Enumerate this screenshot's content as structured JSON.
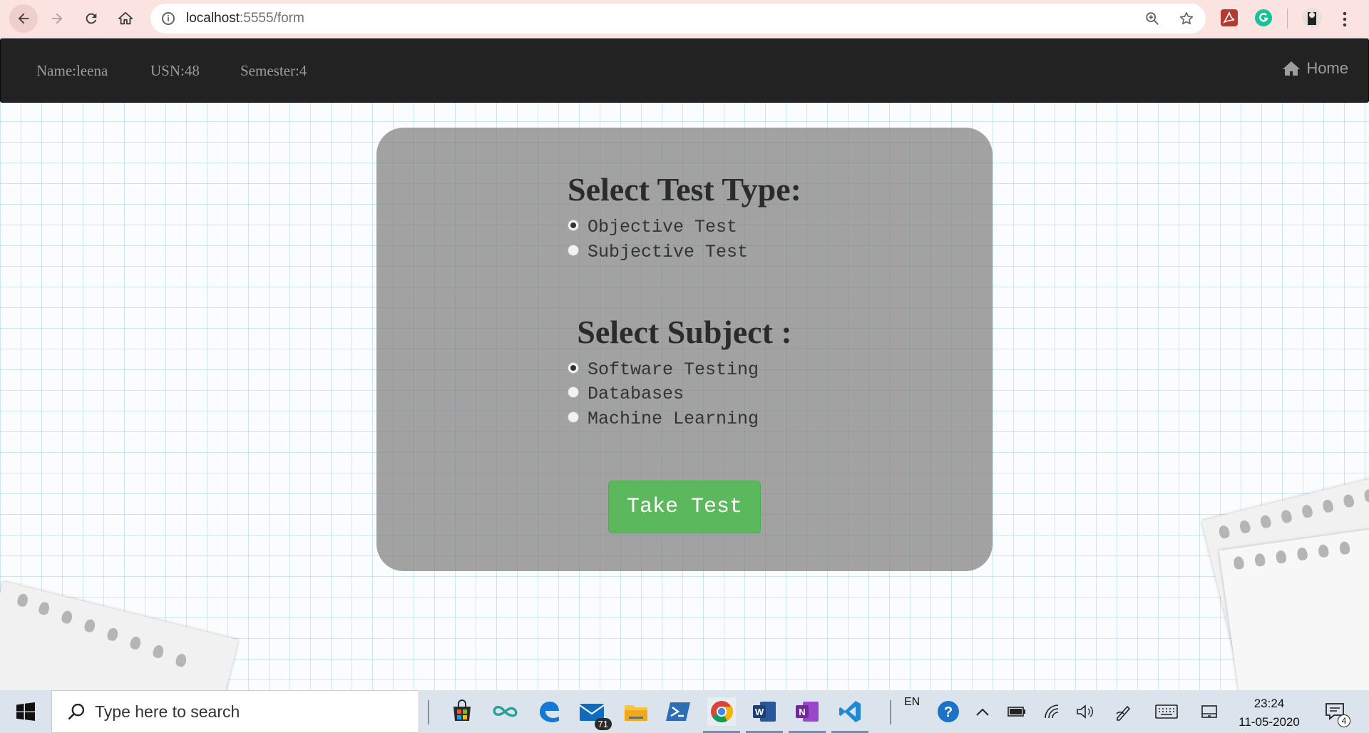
{
  "browser": {
    "url_host": "localhost",
    "url_path": ":5555/form",
    "icons": [
      "back-arrow-icon",
      "forward-arrow-icon",
      "reload-icon",
      "home-icon",
      "zoom-icon",
      "star-icon",
      "acrobat-icon",
      "grammarly-icon",
      "profile-avatar",
      "more-menu-icon"
    ]
  },
  "navbar": {
    "name": "Name:leena",
    "usn": "USN:48",
    "semester": "Semester:4",
    "home": "Home"
  },
  "form": {
    "test_type_heading": "Select Test Type:",
    "test_types": [
      {
        "label": "Objective Test",
        "checked": true
      },
      {
        "label": "Subjective Test",
        "checked": false
      }
    ],
    "subject_heading": "Select Subject :",
    "subjects": [
      {
        "label": "Software Testing",
        "checked": true
      },
      {
        "label": "Databases",
        "checked": false
      },
      {
        "label": "Machine Learning",
        "checked": false
      }
    ],
    "submit": "Take Test",
    "submit_color": "#5cb85c"
  },
  "taskbar": {
    "search_placeholder": "Type here to search",
    "mail_badge": "71",
    "language": "EN",
    "time": "23:24",
    "date": "11-05-2020",
    "notifications": "4"
  }
}
